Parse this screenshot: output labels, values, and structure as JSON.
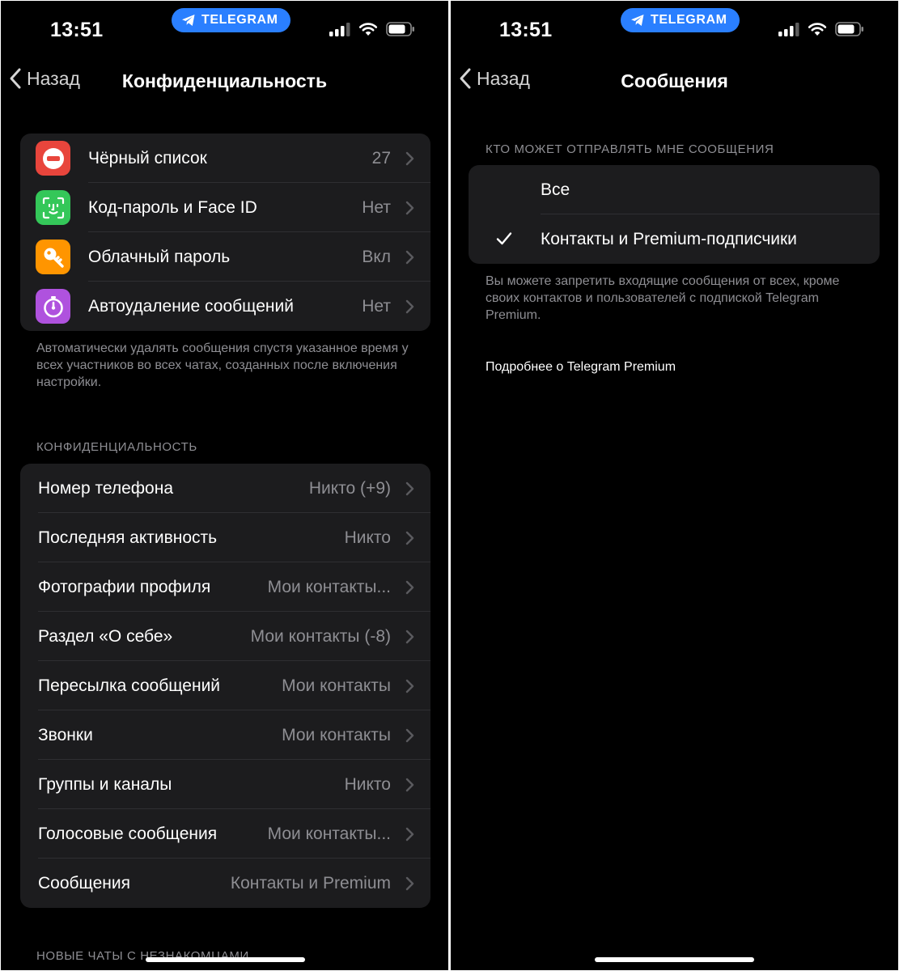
{
  "left": {
    "status": {
      "time": "13:51",
      "pill": "TELEGRAM"
    },
    "nav": {
      "back": "Назад",
      "title": "Конфиденциальность"
    },
    "security_items": [
      {
        "label": "Чёрный список",
        "value": "27",
        "icon": "no-entry-icon",
        "color": "#e8453c"
      },
      {
        "label": "Код-пароль и Face ID",
        "value": "Нет",
        "icon": "face-id-icon",
        "color": "#34c759"
      },
      {
        "label": "Облачный пароль",
        "value": "Вкл",
        "icon": "key-icon",
        "color": "#ff9500"
      },
      {
        "label": "Автоудаление сообщений",
        "value": "Нет",
        "icon": "timer-icon",
        "color": "#af52de"
      }
    ],
    "security_footer": "Автоматически удалять сообщения спустя указанное время у всех участников во всех чатах, созданных после включения настройки.",
    "privacy_header": "КОНФИДЕНЦИАЛЬНОСТЬ",
    "privacy_items": [
      {
        "label": "Номер телефона",
        "value": "Никто (+9)"
      },
      {
        "label": "Последняя активность",
        "value": "Никто"
      },
      {
        "label": "Фотографии профиля",
        "value": "Мои контакты..."
      },
      {
        "label": "Раздел «О себе»",
        "value": "Мои контакты (-8)"
      },
      {
        "label": "Пересылка сообщений",
        "value": "Мои контакты"
      },
      {
        "label": "Звонки",
        "value": "Мои контакты"
      },
      {
        "label": "Группы и каналы",
        "value": "Никто"
      },
      {
        "label": "Голосовые сообщения",
        "value": "Мои контакты..."
      },
      {
        "label": "Сообщения",
        "value": "Контакты и Premium"
      }
    ],
    "next_header": "НОВЫЕ ЧАТЫ С НЕЗНАКОМЦАМИ"
  },
  "right": {
    "status": {
      "time": "13:51",
      "pill": "TELEGRAM"
    },
    "nav": {
      "back": "Назад",
      "title": "Сообщения"
    },
    "section_header": "КТО МОЖЕТ ОТПРАВЛЯТЬ МНЕ СООБЩЕНИЯ",
    "options": [
      {
        "label": "Все",
        "checked": false
      },
      {
        "label": "Контакты и Premium-подписчики",
        "checked": true
      }
    ],
    "footer": "Вы можете запретить входящие сообщения от всех, кроме своих контактов и пользователей с подпиской Telegram Premium.",
    "link": "Подробнее о Telegram Premium"
  },
  "colors": {
    "accent": "#2a7fff",
    "background": "#000000",
    "cell": "#1c1c1e",
    "secondary_text": "#8e8e93"
  }
}
